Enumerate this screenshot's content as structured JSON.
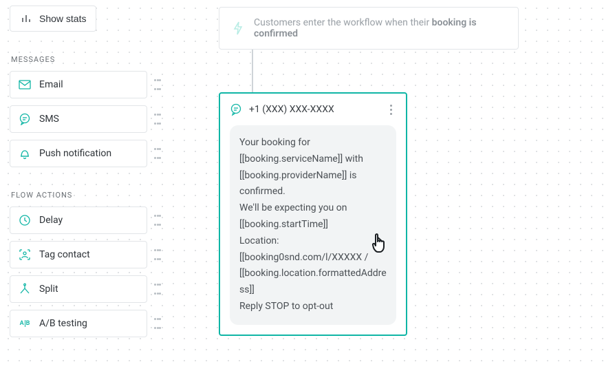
{
  "toolbar": {
    "show_stats": "Show stats"
  },
  "sections": {
    "messages": "MESSAGES",
    "flow_actions": "FLOW ACTIONS"
  },
  "palette": {
    "email": "Email",
    "sms": "SMS",
    "push": "Push notification",
    "delay": "Delay",
    "tag_contact": "Tag contact",
    "split": "Split",
    "ab_testing": "A/B testing"
  },
  "entry": {
    "prefix": "Customers enter the workflow when their ",
    "bold": "booking is confirmed"
  },
  "sms_card": {
    "from": "+1 (XXX) XXX-XXXX",
    "body": "Your booking for [[booking.serviceName]] with [[booking.providerName]] is confirmed.\nWe'll be expecting you on [[booking.startTime]]\nLocation: [[booking0snd.com/l/XXXXX / [[booking.location.formattedAddress]]\nReply STOP to opt-out"
  }
}
